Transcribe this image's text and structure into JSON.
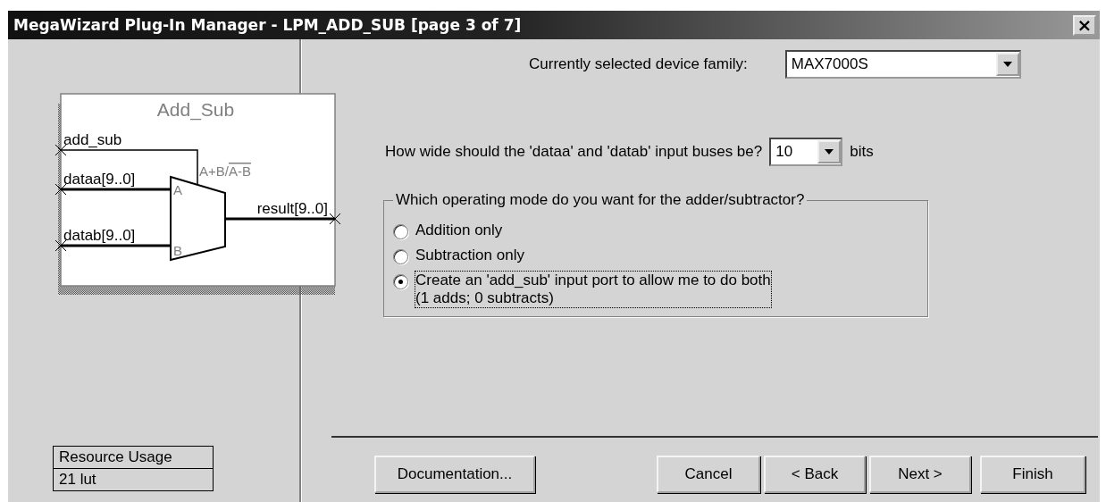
{
  "window": {
    "title": "MegaWizard Plug-In Manager - LPM_ADD_SUB [page 3 of 7]",
    "close": "×"
  },
  "symbol": {
    "title": "Add_Sub",
    "ports": [
      "add_sub",
      "dataa[9..0]",
      "datab[9..0]"
    ],
    "output": "result[9..0]",
    "operation": "A+B/",
    "operation_bar": "A-B",
    "input_a": "A",
    "input_b": "B"
  },
  "resource_usage": {
    "heading": "Resource Usage",
    "value": "21 lut"
  },
  "device_family": {
    "label": "Currently selected device family:",
    "value": "MAX7000S"
  },
  "bus_width": {
    "label": "How wide should the 'dataa' and 'datab' input buses be?",
    "value": "10",
    "unit": "bits"
  },
  "mode_group": {
    "legend": "Which operating mode do you want for the adder/subtractor?",
    "options": [
      {
        "label": "Addition only",
        "selected": false,
        "focused": false
      },
      {
        "label": "Subtraction only",
        "selected": false,
        "focused": false
      },
      {
        "label": "Create an 'add_sub' input port to allow me to do both",
        "note": "(1 adds; 0 subtracts)",
        "selected": true,
        "focused": true
      }
    ]
  },
  "buttons": [
    {
      "label": "Documentation..."
    },
    {
      "label": "Cancel"
    },
    {
      "label": "< Back"
    },
    {
      "label": "Next >"
    },
    {
      "label": "Finish"
    }
  ]
}
